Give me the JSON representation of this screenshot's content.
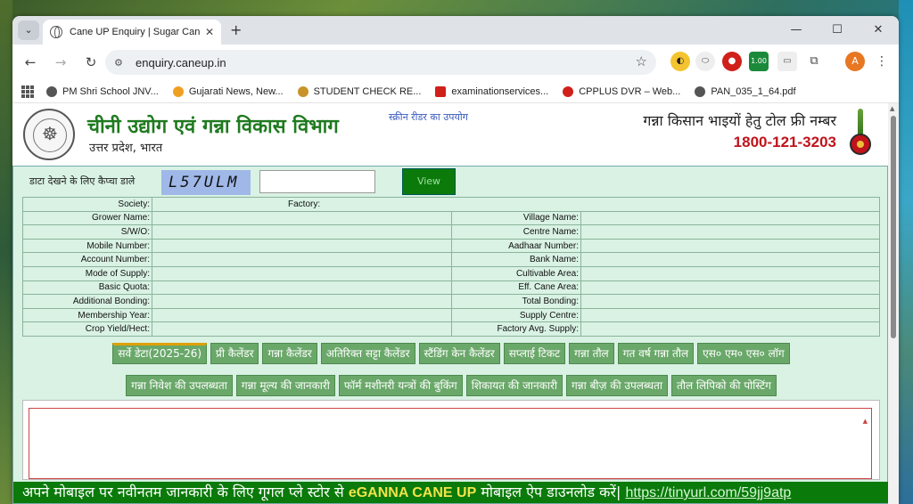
{
  "browser": {
    "tab_title": "Cane UP Enquiry | Sugar Cane a",
    "url": "enquiry.caneup.in",
    "extension_badge": "1.00",
    "profile_initial": "A",
    "bookmarks": [
      {
        "label": "PM Shri School JNV...",
        "color": "#555555"
      },
      {
        "label": "Gujarati News, New...",
        "color": "#f0a020"
      },
      {
        "label": "STUDENT CHECK RE...",
        "color": "#c8932a"
      },
      {
        "label": "examinationservices...",
        "color": "#d0201a"
      },
      {
        "label": "CPPLUS DVR – Web...",
        "color": "#d0201a"
      },
      {
        "label": "PAN_035_1_64.pdf",
        "color": "#555555"
      }
    ]
  },
  "header": {
    "dept_title": "चीनी उद्योग एवं गन्ना विकास विभाग",
    "dept_subtitle": "उत्तर प्रदेश, भारत",
    "screen_reader": "स्क्रीन रीडर का उपयोग",
    "tollfree_label": "गन्ना किसान भाइयों हेतु टोल फ्री नम्बर",
    "tollfree_number": "1800-121-3203"
  },
  "captcha": {
    "label": "डाटा देखने के लिए कैप्चा डाले",
    "code": "L57ULM",
    "input_value": "",
    "view_label": "View"
  },
  "info_table": {
    "society_label": "Society:",
    "factory_label": "Factory:",
    "rows": [
      {
        "left": "Grower Name:",
        "right": "Village Name:"
      },
      {
        "left": "S/W/O:",
        "right": "Centre Name:"
      },
      {
        "left": "Mobile Number:",
        "right": "Aadhaar Number:"
      },
      {
        "left": "Account Number:",
        "right": "Bank Name:"
      },
      {
        "left": "Mode of Supply:",
        "right": "Cultivable Area:"
      },
      {
        "left": "Basic Quota:",
        "right": "Eff. Cane Area:"
      },
      {
        "left": "Additional Bonding:",
        "right": "Total Bonding:"
      },
      {
        "left": "Membership Year:",
        "right": "Supply Centre:"
      },
      {
        "left": "Crop Yield/Hect:",
        "right": "Factory Avg. Supply:"
      }
    ]
  },
  "buttons_row1": [
    "सर्वे डेटा(2025-26)",
    "प्री कैलेंडर",
    "गन्ना कैलेंडर",
    "अतिरिक्त सट्टा कैलेंडर",
    "स्टैंडिंग केन कैलेंडर",
    "सप्लाई टिकट",
    "गन्ना तौल",
    "गत वर्ष गन्ना तौल",
    "एस० एम० एस० लॉग"
  ],
  "buttons_row2": [
    "गन्ना निवेश की उपलब्धता",
    "गन्ना मूल्य की जानकारी",
    "फॉर्म मशीनरी यन्त्रों की बुकिंग",
    "शिकायत की जानकारी",
    "गन्ना बीज़ की उपलब्धता",
    "तौल लिपिको की पोस्टिंग"
  ],
  "ticker": {
    "prefix": "अपने मोबाइल पर नवीनतम जानकारी के लिए गूगल प्ले स्टोर से ",
    "app_name": "eGANNA CANE UP",
    "suffix": " मोबाइल ऐप डाउनलोड करें| ",
    "link": "https://tinyurl.com/59jj9atp"
  }
}
